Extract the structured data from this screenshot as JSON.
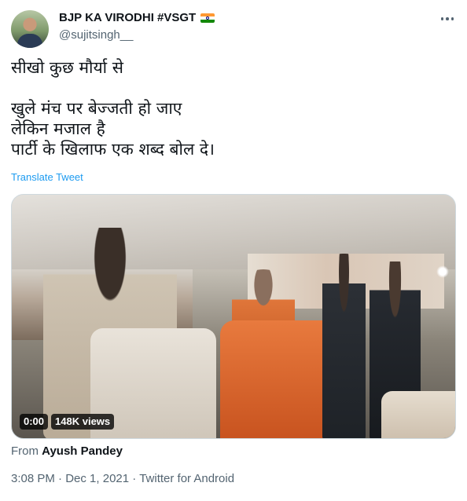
{
  "author": {
    "display_name": "BJP KA VIRODHI #VSGT",
    "handle": "@sujitsingh__",
    "badge_icon": "india-flag-icon"
  },
  "tweet": {
    "text": "सीखो कुछ मौर्या से\n\nखुले मंच पर बेज्जती हो जाए\nलेकिन मजाल है\nपार्टी के खिलाफ एक शब्द बोल दे।",
    "translate_label": "Translate Tweet"
  },
  "media": {
    "duration": "0:00",
    "views": "148K views"
  },
  "attribution": {
    "prefix": "From",
    "source": "Ayush Pandey"
  },
  "meta": {
    "time": "3:08 PM",
    "separator": "·",
    "date": "Dec 1, 2021",
    "client": "Twitter for Android"
  },
  "colors": {
    "link": "#1d9bf0",
    "secondary_text": "#536471",
    "primary_text": "#0f1419"
  },
  "icons": {
    "more": "more-options-icon",
    "flag": "india-flag-icon"
  }
}
